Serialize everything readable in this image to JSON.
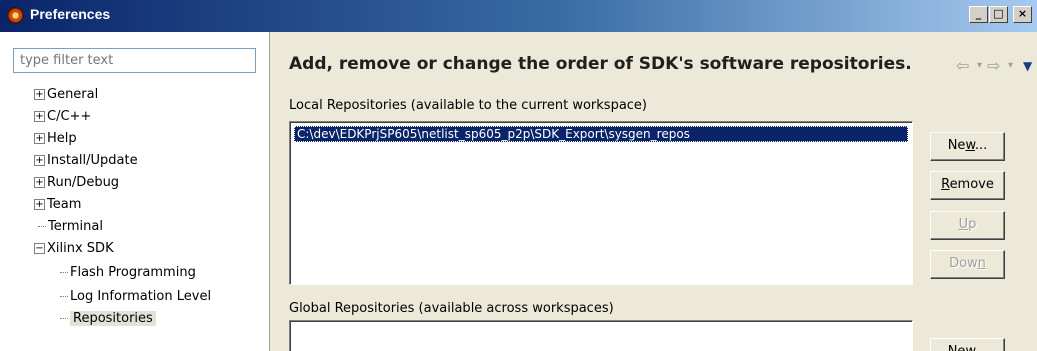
{
  "window": {
    "title": "Preferences",
    "controls": {
      "minimize": "_",
      "maximize": "□",
      "close": "×"
    }
  },
  "filter": {
    "placeholder": "type filter text"
  },
  "tree": {
    "items": [
      {
        "label": "General",
        "expander": "+"
      },
      {
        "label": "C/C++",
        "expander": "+"
      },
      {
        "label": "Help",
        "expander": "+"
      },
      {
        "label": "Install/Update",
        "expander": "+"
      },
      {
        "label": "Run/Debug",
        "expander": "+"
      },
      {
        "label": "Team",
        "expander": "+"
      },
      {
        "label": "Terminal",
        "expander": ""
      },
      {
        "label": "Xilinx SDK",
        "expander": "−"
      },
      {
        "label": "Flash Programming",
        "expander": ""
      },
      {
        "label": "Log Information Level",
        "expander": ""
      },
      {
        "label": "Repositories",
        "expander": ""
      }
    ]
  },
  "page": {
    "header": "Add, remove or change the order of SDK's software repositories.",
    "local_label": "Local Repositories (available to the current workspace)",
    "global_label": "Global Repositories (available across workspaces)",
    "local_items": [
      "C:\\dev\\EDKPrjSP605\\netlist_sp605_p2p\\SDK_Export\\sysgen_repos"
    ],
    "buttons": {
      "new1_pre": "Ne",
      "new1_key": "w",
      "new1_post": "...",
      "remove_key": "R",
      "remove_post": "emove",
      "up_key": "U",
      "up_post": "p",
      "down_pre": "Dow",
      "down_key": "n",
      "new2_pre": "Ne",
      "new2_key": "w",
      "new2_post": "..."
    }
  },
  "colors": {
    "title_start": "#0a246a",
    "title_end": "#a6caf0",
    "selection": "#0a246a"
  },
  "icons": [
    "app-icon",
    "back-arrow-icon",
    "forward-arrow-icon",
    "view-menu-icon"
  ]
}
